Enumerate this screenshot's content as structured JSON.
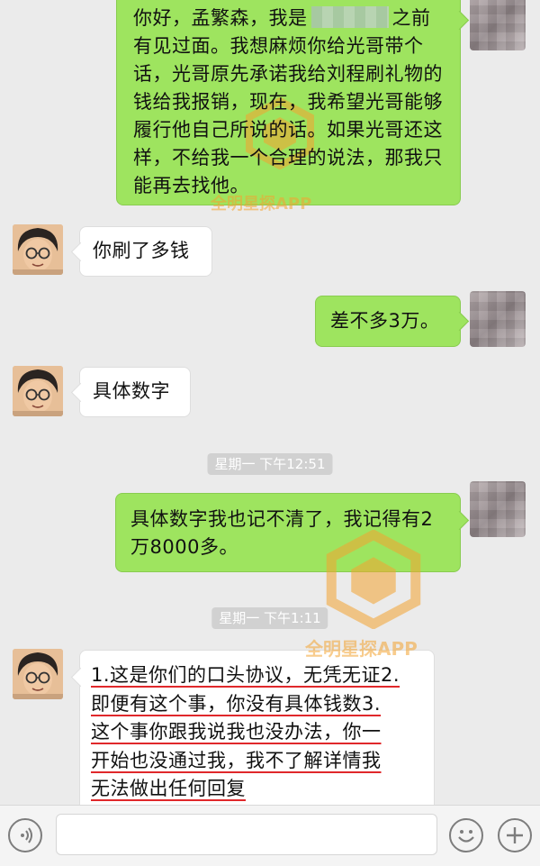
{
  "messages": [
    {
      "sender": "self",
      "parts": [
        "你好，孟繁森，我是",
        "之前有见过面。我想麻烦你给光哥带个话，光哥原先承诺我给刘程刷礼物的钱给我报销，现在，我希望光哥能够履行他自己所说的话。如果光哥还这样，不给我一个合理的说法，那我只能再去找他。"
      ]
    },
    {
      "sender": "other",
      "text": "你刷了多钱"
    },
    {
      "sender": "self",
      "text": "差不多3万。"
    },
    {
      "sender": "other",
      "text": "具体数字"
    },
    {
      "sender": "self",
      "text": "具体数字我也记不清了，我记得有2万8000多。"
    },
    {
      "sender": "other",
      "lines": [
        "1.这是你们的口头协议，无凭无证2.",
        "即便有这个事，你没有具体钱数3.",
        "这个事你跟我说我也没办法，你一",
        "开始也没通过我，我不了解详情我",
        "无法做出任何回复"
      ]
    }
  ],
  "timestamps": [
    "星期一 下午12:51",
    "星期一 下午1:11"
  ],
  "watermark": "全明星探APP",
  "input_bar": {
    "voice_icon": "voice-icon",
    "emoji_icon": "emoji-icon",
    "plus_icon": "plus-icon",
    "text_value": ""
  },
  "colors": {
    "self_bubble": "#9ee45f",
    "other_bubble": "#ffffff",
    "background": "#ebebeb",
    "watermark": "#f4a431",
    "underline": "#e0282b"
  }
}
